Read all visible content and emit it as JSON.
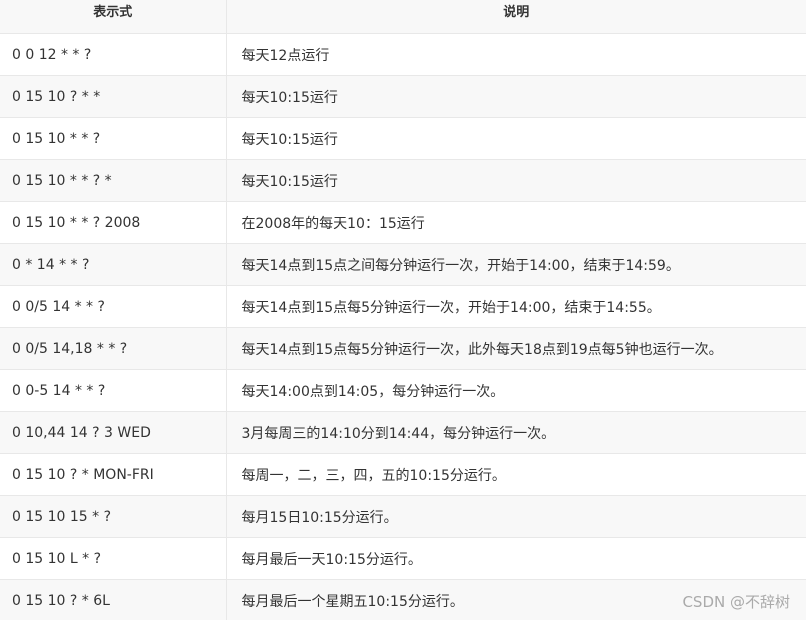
{
  "headers": {
    "expression": "表示式",
    "description": "说明"
  },
  "rows": [
    {
      "expression": "0 0 12 * * ?",
      "description": "每天12点运行"
    },
    {
      "expression": "0 15 10 ? * *",
      "description": "每天10:15运行"
    },
    {
      "expression": "0 15 10 * * ?",
      "description": "每天10:15运行"
    },
    {
      "expression": "0 15 10 * * ? *",
      "description": "每天10:15运行"
    },
    {
      "expression": "0 15 10 * * ? 2008",
      "description": "在2008年的每天10：15运行"
    },
    {
      "expression": "0 * 14 * * ?",
      "description": "每天14点到15点之间每分钟运行一次，开始于14:00，结束于14:59。"
    },
    {
      "expression": "0 0/5 14 * * ?",
      "description": "每天14点到15点每5分钟运行一次，开始于14:00，结束于14:55。"
    },
    {
      "expression": "0 0/5 14,18 * * ?",
      "description": "每天14点到15点每5分钟运行一次，此外每天18点到19点每5钟也运行一次。"
    },
    {
      "expression": "0 0-5 14 * * ?",
      "description": "每天14:00点到14:05，每分钟运行一次。"
    },
    {
      "expression": "0 10,44 14 ? 3 WED",
      "description": "3月每周三的14:10分到14:44，每分钟运行一次。"
    },
    {
      "expression": "0 15 10 ? * MON-FRI",
      "description": "每周一，二，三，四，五的10:15分运行。"
    },
    {
      "expression": "0 15 10 15 * ?",
      "description": "每月15日10:15分运行。"
    },
    {
      "expression": "0 15 10 L * ?",
      "description": "每月最后一天10:15分运行。"
    },
    {
      "expression": "0 15 10 ? * 6L",
      "description": "每月最后一个星期五10:15分运行。"
    }
  ],
  "watermark": "CSDN @不辞树"
}
